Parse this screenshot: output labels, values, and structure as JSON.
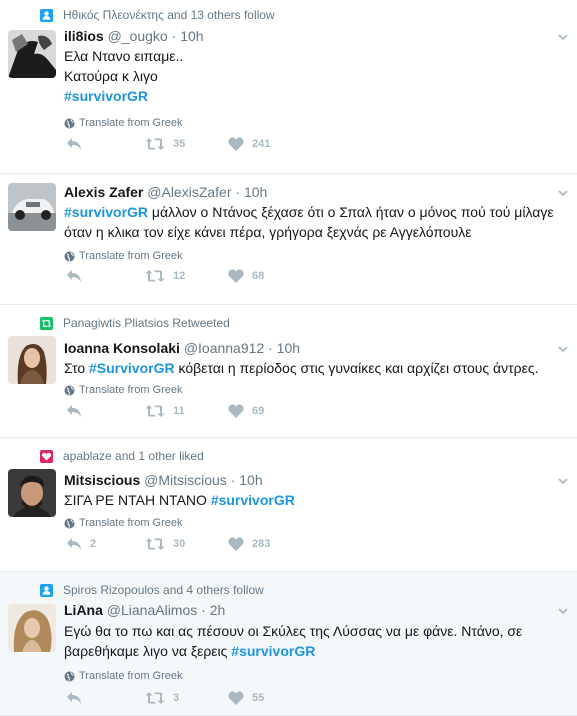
{
  "tweets": [
    {
      "context_type": "follow",
      "context_text": "Ηθικός Πλεονέκτης and 13 others follow",
      "name": "ili8ios",
      "handle": "@_ougko",
      "sep": "·",
      "time": "10h",
      "lines": [
        {
          "pre": "Ελα Ντανο ειπαμε..",
          "tag": "",
          "post": ""
        },
        {
          "pre": "Κατούρα κ λιγο",
          "tag": "",
          "post": ""
        },
        {
          "pre": "",
          "tag": "#survivorGR",
          "post": ""
        }
      ],
      "translate": "Translate from Greek",
      "replies": "",
      "retweets": "35",
      "likes": "241"
    },
    {
      "context_type": "",
      "context_text": "",
      "name": "Alexis Zafer",
      "handle": "@AlexisZafer",
      "sep": "·",
      "time": "10h",
      "lines": [
        {
          "pre": "",
          "tag": "#survivorGR",
          "post": " μάλλον ο Ντάνος ξέχασε ότι ο Σπαλ ήταν ο μόνος πού τού μίλαγε"
        },
        {
          "pre": "όταν η κλικα τον είχε κάνει πέρα, γρήγορα ξεχνάς ρε Αγγελόπουλε",
          "tag": "",
          "post": ""
        }
      ],
      "translate": "Translate from Greek",
      "replies": "",
      "retweets": "12",
      "likes": "68"
    },
    {
      "context_type": "retweet",
      "context_text": "Panagiwtis Pliatsios Retweeted",
      "name": "Ioanna Konsolaki",
      "handle": "@Ioanna912",
      "sep": "·",
      "time": "10h",
      "lines": [
        {
          "pre": "Στο ",
          "tag": "#SurvivorGR",
          "post": " κόβεται η περίοδος στις γυναίκες και αρχίζει στους άντρες."
        }
      ],
      "translate": "Translate from Greek",
      "replies": "",
      "retweets": "11",
      "likes": "69"
    },
    {
      "context_type": "like",
      "context_text": "apablaze and 1 other liked",
      "name": "Mitsiscious",
      "handle": "@Mitsiscious",
      "sep": "·",
      "time": "10h",
      "lines": [
        {
          "pre": "ΣΙΓΑ ΡΕ ΝΤΑΗ ΝΤΑΝΟ ",
          "tag": "#survivorGR",
          "post": ""
        }
      ],
      "translate": "Translate from Greek",
      "replies": "2",
      "retweets": "30",
      "likes": "283"
    },
    {
      "context_type": "follow",
      "context_text": "Spiros Rizopoulos and 4 others follow",
      "name": "LiAna",
      "handle": "@LianaAlimos",
      "sep": "·",
      "time": "2h",
      "lines": [
        {
          "pre": "Εγώ θα το πω και ας πέσουν οι Σκύλες της Λύσσας να με φάνε. Ντάνο, σε",
          "tag": "",
          "post": ""
        },
        {
          "pre": "βαρεθήκαμε λιγο να ξερεις ",
          "tag": "#survivorGR",
          "post": ""
        }
      ],
      "translate": "Translate from Greek",
      "replies": "",
      "retweets": "3",
      "likes": "55"
    }
  ],
  "colors": {
    "follow_icon": "#1da1f2",
    "retweet_icon": "#17bf63",
    "like_icon": "#e0245e",
    "hashtag": "#1b95e0",
    "muted": "#657786",
    "action": "#aab8c2"
  }
}
